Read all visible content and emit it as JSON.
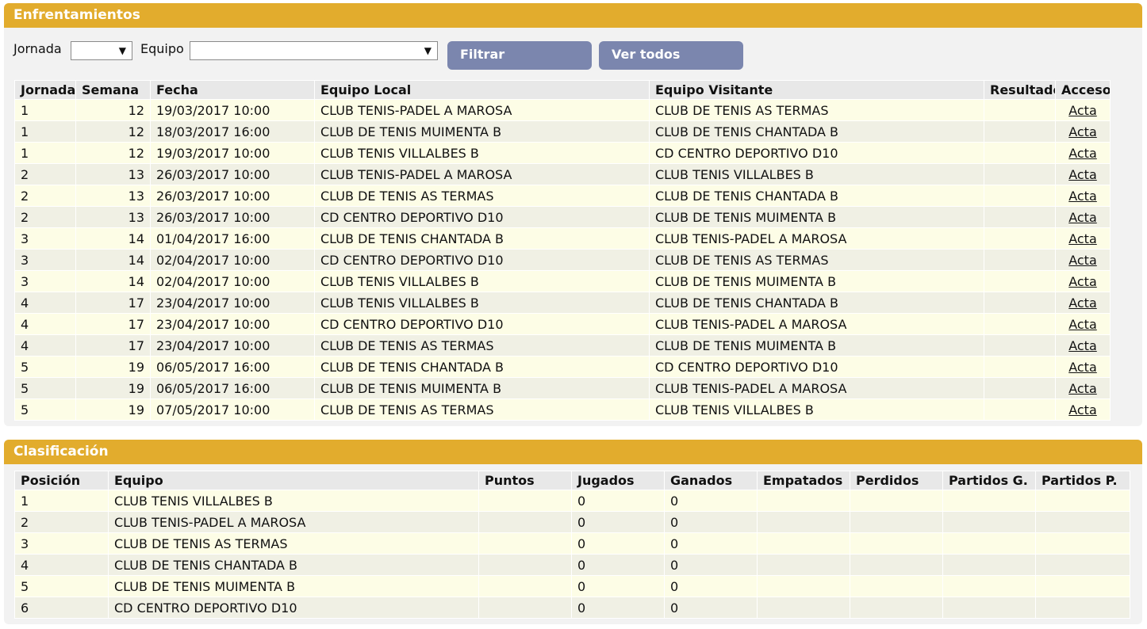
{
  "enfrentamientos": {
    "title": "Enfrentamientos",
    "filters": {
      "jornada_label": "Jornada",
      "equipo_label": "Equipo",
      "jornada_value": "",
      "equipo_value": "",
      "filter_button": "Filtrar",
      "all_button": "Ver todos"
    },
    "columns": [
      "Jornada",
      "Semana",
      "Fecha",
      "Equipo Local",
      "Equipo Visitante",
      "Resultado",
      "Acceso"
    ],
    "rows": [
      {
        "jornada": "1",
        "semana": "12",
        "fecha": "19/03/2017 10:00",
        "local": "CLUB TENIS-PADEL A MAROSA",
        "visitante": "CLUB DE TENIS AS TERMAS",
        "resultado": "",
        "acceso": "Acta"
      },
      {
        "jornada": "1",
        "semana": "12",
        "fecha": "18/03/2017 16:00",
        "local": "CLUB DE TENIS MUIMENTA B",
        "visitante": "CLUB DE TENIS CHANTADA B",
        "resultado": "",
        "acceso": "Acta"
      },
      {
        "jornada": "1",
        "semana": "12",
        "fecha": "19/03/2017 10:00",
        "local": "CLUB TENIS VILLALBES B",
        "visitante": "CD CENTRO DEPORTIVO D10",
        "resultado": "",
        "acceso": "Acta"
      },
      {
        "jornada": "2",
        "semana": "13",
        "fecha": "26/03/2017 10:00",
        "local": "CLUB TENIS-PADEL A MAROSA",
        "visitante": "CLUB TENIS VILLALBES B",
        "resultado": "",
        "acceso": "Acta"
      },
      {
        "jornada": "2",
        "semana": "13",
        "fecha": "26/03/2017 10:00",
        "local": "CLUB DE TENIS AS TERMAS",
        "visitante": "CLUB DE TENIS CHANTADA B",
        "resultado": "",
        "acceso": "Acta"
      },
      {
        "jornada": "2",
        "semana": "13",
        "fecha": "26/03/2017 10:00",
        "local": "CD CENTRO DEPORTIVO D10",
        "visitante": "CLUB DE TENIS MUIMENTA B",
        "resultado": "",
        "acceso": "Acta"
      },
      {
        "jornada": "3",
        "semana": "14",
        "fecha": "01/04/2017 16:00",
        "local": "CLUB DE TENIS CHANTADA B",
        "visitante": "CLUB TENIS-PADEL A MAROSA",
        "resultado": "",
        "acceso": "Acta"
      },
      {
        "jornada": "3",
        "semana": "14",
        "fecha": "02/04/2017 10:00",
        "local": "CD CENTRO DEPORTIVO D10",
        "visitante": "CLUB DE TENIS AS TERMAS",
        "resultado": "",
        "acceso": "Acta"
      },
      {
        "jornada": "3",
        "semana": "14",
        "fecha": "02/04/2017 10:00",
        "local": "CLUB TENIS VILLALBES B",
        "visitante": "CLUB DE TENIS MUIMENTA B",
        "resultado": "",
        "acceso": "Acta"
      },
      {
        "jornada": "4",
        "semana": "17",
        "fecha": "23/04/2017 10:00",
        "local": "CLUB TENIS VILLALBES B",
        "visitante": "CLUB DE TENIS CHANTADA B",
        "resultado": "",
        "acceso": "Acta"
      },
      {
        "jornada": "4",
        "semana": "17",
        "fecha": "23/04/2017 10:00",
        "local": "CD CENTRO DEPORTIVO D10",
        "visitante": "CLUB TENIS-PADEL A MAROSA",
        "resultado": "",
        "acceso": "Acta"
      },
      {
        "jornada": "4",
        "semana": "17",
        "fecha": "23/04/2017 10:00",
        "local": "CLUB DE TENIS AS TERMAS",
        "visitante": "CLUB DE TENIS MUIMENTA B",
        "resultado": "",
        "acceso": "Acta"
      },
      {
        "jornada": "5",
        "semana": "19",
        "fecha": "06/05/2017 16:00",
        "local": "CLUB DE TENIS CHANTADA B",
        "visitante": "CD CENTRO DEPORTIVO D10",
        "resultado": "",
        "acceso": "Acta"
      },
      {
        "jornada": "5",
        "semana": "19",
        "fecha": "06/05/2017 16:00",
        "local": "CLUB DE TENIS MUIMENTA B",
        "visitante": "CLUB TENIS-PADEL A MAROSA",
        "resultado": "",
        "acceso": "Acta"
      },
      {
        "jornada": "5",
        "semana": "19",
        "fecha": "07/05/2017 10:00",
        "local": "CLUB DE TENIS AS TERMAS",
        "visitante": "CLUB TENIS VILLALBES B",
        "resultado": "",
        "acceso": "Acta"
      }
    ]
  },
  "clasificacion": {
    "title": "Clasificación",
    "columns": [
      "Posición",
      "Equipo",
      "Puntos",
      "Jugados",
      "Ganados",
      "Empatados",
      "Perdidos",
      "Partidos G.",
      "Partidos P."
    ],
    "rows": [
      {
        "posicion": "1",
        "equipo": "CLUB TENIS VILLALBES B",
        "puntos": "",
        "jugados": "0",
        "ganados": "0",
        "empatados": "",
        "perdidos": "",
        "partidos_g": "",
        "partidos_p": ""
      },
      {
        "posicion": "2",
        "equipo": "CLUB TENIS-PADEL A MAROSA",
        "puntos": "",
        "jugados": "0",
        "ganados": "0",
        "empatados": "",
        "perdidos": "",
        "partidos_g": "",
        "partidos_p": ""
      },
      {
        "posicion": "3",
        "equipo": "CLUB DE TENIS AS TERMAS",
        "puntos": "",
        "jugados": "0",
        "ganados": "0",
        "empatados": "",
        "perdidos": "",
        "partidos_g": "",
        "partidos_p": ""
      },
      {
        "posicion": "4",
        "equipo": "CLUB DE TENIS CHANTADA B",
        "puntos": "",
        "jugados": "0",
        "ganados": "0",
        "empatados": "",
        "perdidos": "",
        "partidos_g": "",
        "partidos_p": ""
      },
      {
        "posicion": "5",
        "equipo": "CLUB DE TENIS MUIMENTA B",
        "puntos": "",
        "jugados": "0",
        "ganados": "0",
        "empatados": "",
        "perdidos": "",
        "partidos_g": "",
        "partidos_p": ""
      },
      {
        "posicion": "6",
        "equipo": "CD CENTRO DEPORTIVO D10",
        "puntos": "",
        "jugados": "0",
        "ganados": "0",
        "empatados": "",
        "perdidos": "",
        "partidos_g": "",
        "partidos_p": ""
      }
    ]
  },
  "colors": {
    "header_bg": "#e2ac2d",
    "button_bg": "#7b86ae",
    "row_odd": "#fdfde6",
    "row_even": "#f0f0e4"
  },
  "icons": {
    "dropdown": "chevron-down-icon"
  }
}
